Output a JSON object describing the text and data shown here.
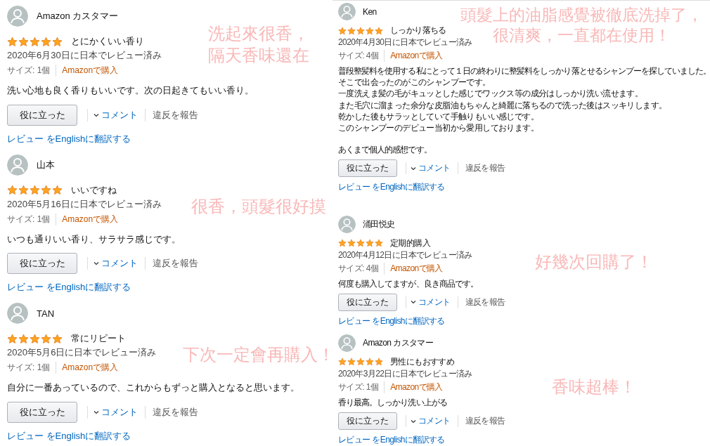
{
  "columns": [
    {
      "reviews": [
        {
          "name": "Amazon カスタマー",
          "stars": 5,
          "title": "とにかくいい香り",
          "date": "2020年6月30日に日本でレビュー済み",
          "size": "サイズ: 1個",
          "purchase": "Amazonで購入",
          "paragraphs": [
            [
              "洗い心地も良く香りもいいです。次の日起きてもいい香り。"
            ]
          ],
          "helpful": "役に立った",
          "comment": "コメント",
          "report": "違反を報告",
          "translate": "レビュー をEnglishに翻訳する",
          "note": [
            "洗起來很香，",
            "隔天香味還在"
          ]
        },
        {
          "name": "山本",
          "stars": 5,
          "title": "いいですね",
          "date": "2020年5月16日に日本でレビュー済み",
          "size": "サイズ: 1個",
          "purchase": "Amazonで購入",
          "paragraphs": [
            [
              "いつも通りいい香り、サラサラ感じです。"
            ]
          ],
          "helpful": "役に立った",
          "comment": "コメント",
          "report": "違反を報告",
          "translate": "レビュー をEnglishに翻訳する",
          "note": [
            "很香，頭髮很好摸"
          ]
        },
        {
          "name": "TAN",
          "stars": 5,
          "title": "常にリピート",
          "date": "2020年5月6日に日本でレビュー済み",
          "size": "サイズ: 1個",
          "purchase": "Amazonで購入",
          "paragraphs": [
            [
              "自分に一番あっているので、これからもずっと購入となると思います。"
            ]
          ],
          "helpful": "役に立った",
          "comment": "コメント",
          "report": "違反を報告",
          "translate": "レビュー をEnglishに翻訳する",
          "note": [
            "下次一定會再購入！"
          ]
        }
      ]
    },
    {
      "reviews": [
        {
          "name": "Ken",
          "stars": 5,
          "title": "しっかり落ちる",
          "date": "2020年4月30日に日本でレビュー済み",
          "size": "サイズ: 4個",
          "purchase": "Amazonで購入",
          "paragraphs": [
            [
              "普段整髪料を使用する私にとって１日の終わりに整髪料をしっかり落とせるシャンプーを探していました。",
              "そこで出会ったのがこのシャンプーです。",
              "一度洗えま髪の毛がキュッとした感じでワックス等の成分はしっかり洗い流せます。",
              "また毛穴に溜まった余分な皮脂油もちゃんと綺麗に落ちるので洗った後はスッキリします。",
              "乾かした後もサラッとしていて手触りもいい感じです。",
              "このシャンプーのデビュー当初から愛用しております。"
            ],
            [
              "あくまで個人的感想です。"
            ]
          ],
          "helpful": "役に立った",
          "comment": "コメント",
          "report": "違反を報告",
          "translate": "レビュー をEnglishに翻訳する",
          "note": [
            "頭髮上的油脂感覺被徹底洗掉了，",
            "很清爽，一直都在使用！"
          ]
        },
        {
          "name": "涌田悦史",
          "stars": 5,
          "title": "定期的購入",
          "date": "2020年4月12日に日本でレビュー済み",
          "size": "サイズ: 4個",
          "purchase": "Amazonで購入",
          "paragraphs": [
            [
              "何度も購入してますが、良き商品です。"
            ]
          ],
          "helpful": "役に立った",
          "comment": "コメント",
          "report": "違反を報告",
          "translate": "レビュー をEnglishに翻訳する",
          "note": [
            "好幾次回購了！"
          ]
        },
        {
          "name": "Amazon カスタマー",
          "stars": 5,
          "title": "男性にもおすすめ",
          "date": "2020年3月22日に日本でレビュー済み",
          "size": "サイズ: 1個",
          "purchase": "Amazonで購入",
          "paragraphs": [
            [
              "香り最高。しっかり洗い上がる"
            ]
          ],
          "helpful": "役に立った",
          "comment": "コメント",
          "report": "違反を報告",
          "translate": "レビュー をEnglishに翻訳する",
          "note": [
            "香味超棒！"
          ]
        }
      ]
    }
  ]
}
